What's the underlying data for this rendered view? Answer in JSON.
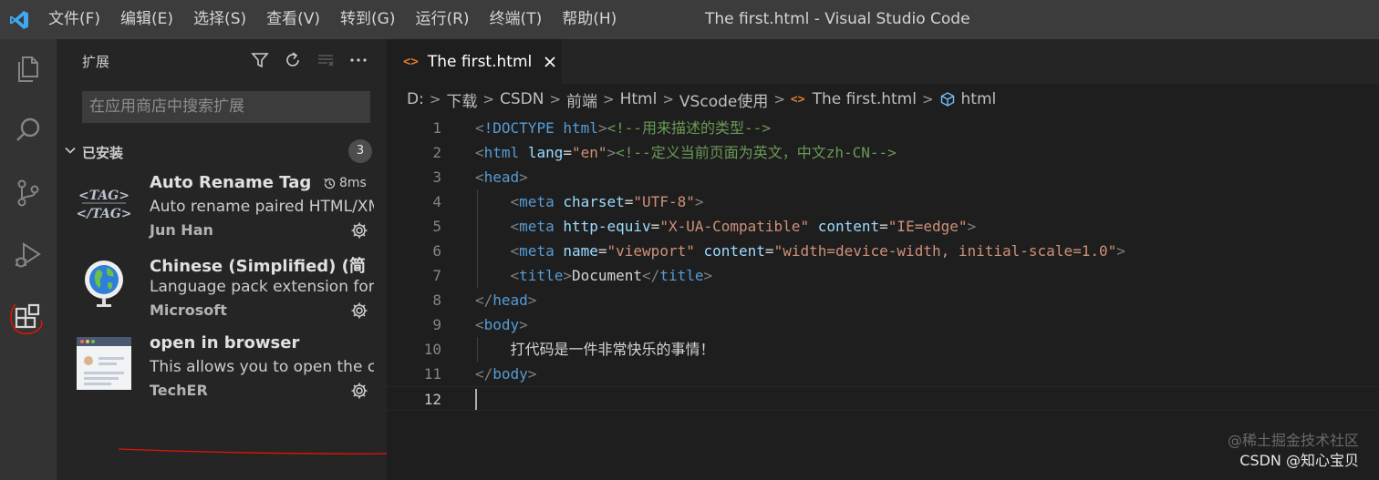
{
  "window": {
    "title": "The first.html - Visual Studio Code",
    "menus": [
      "文件(F)",
      "编辑(E)",
      "选择(S)",
      "查看(V)",
      "转到(G)",
      "运行(R)",
      "终端(T)",
      "帮助(H)"
    ]
  },
  "activity_bar": {
    "items": [
      "files-icon",
      "search-icon",
      "source-control-icon",
      "run-debug-icon",
      "extensions-icon"
    ],
    "active": "extensions-icon"
  },
  "sidebar": {
    "title": "扩展",
    "search_placeholder": "在应用商店中搜索扩展",
    "section": {
      "label": "已安装",
      "count": "3"
    },
    "extensions": [
      {
        "name": "Auto Rename Tag",
        "description": "Auto rename paired HTML/XML tag",
        "publisher": "Jun Han",
        "activation_time": "8ms",
        "icon": "auto-rename-tag-icon"
      },
      {
        "name": "Chinese (Simplified) (简体中文) Language Pack",
        "description": "Language pack extension for Chinese (Simplified)",
        "publisher": "Microsoft",
        "icon": "globe-icon"
      },
      {
        "name": "open in browser",
        "description": "This allows you to open the current file in your default browser",
        "publisher": "TechER",
        "icon": "browser-window-icon"
      }
    ]
  },
  "editor": {
    "tab": {
      "label": "The first.html",
      "icon": "html-file-icon"
    },
    "breadcrumb": [
      "D:",
      "下载",
      "CSDN",
      "前端",
      "Html",
      "VScode使用",
      "The first.html",
      "html"
    ],
    "current_line": 12,
    "line_numbers": [
      "1",
      "2",
      "3",
      "4",
      "5",
      "6",
      "7",
      "8",
      "9",
      "10",
      "11",
      "12"
    ],
    "code_lines": [
      "<!DOCTYPE html><!--用来描述的类型-->",
      "<html lang=\"en\"><!--定义当前页面为英文，中文zh-CN-->",
      "<head>",
      "    <meta charset=\"UTF-8\">",
      "    <meta http-equiv=\"X-UA-Compatible\" content=\"IE=edge\">",
      "    <meta name=\"viewport\" content=\"width=device-width, initial-scale=1.0\">",
      "    <title>Document</title>",
      "</head>",
      "<body>",
      "    打代码是一件非常快乐的事情！",
      "</body>",
      ""
    ]
  },
  "watermark": {
    "line1": "@稀土掘金技术社区",
    "line2": "CSDN @知心宝贝"
  },
  "colors": {
    "accent": "#007acc",
    "annotation_red": "#e51400",
    "html_icon": "#e37933"
  }
}
